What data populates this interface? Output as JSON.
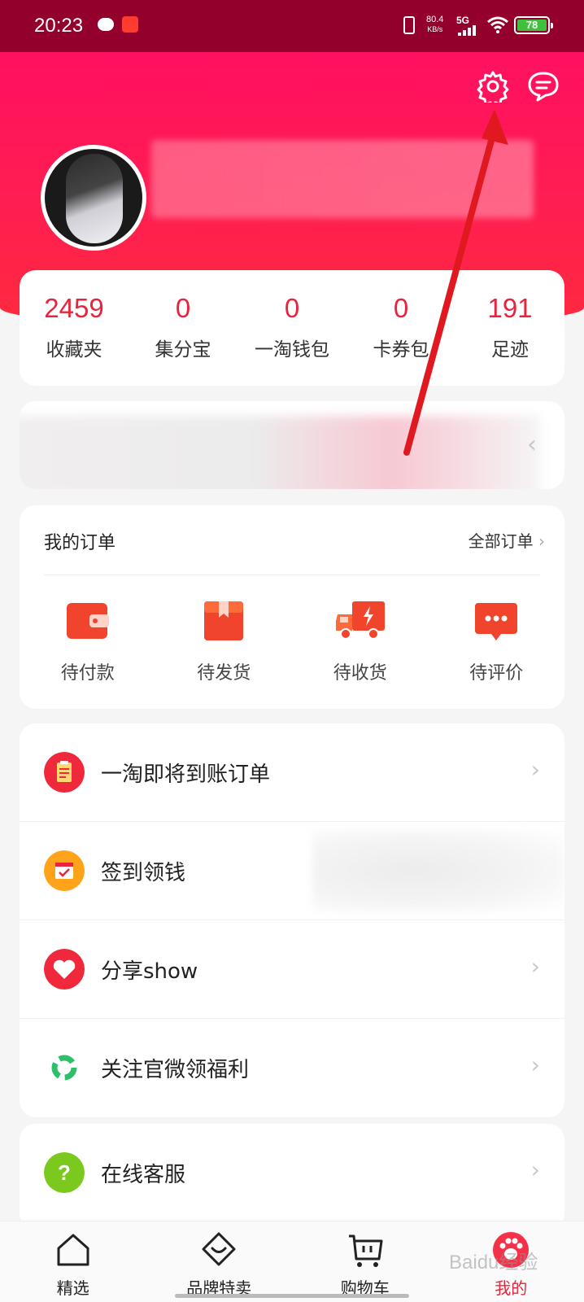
{
  "status_bar": {
    "time": "20:23",
    "net_speed_value": "80.4",
    "net_speed_unit": "KB/s",
    "network": "5G",
    "battery": "78"
  },
  "header": {
    "settings_icon": "gear-icon",
    "message_icon": "chat-bubble-icon"
  },
  "stats": [
    {
      "value": "2459",
      "label": "收藏夹"
    },
    {
      "value": "0",
      "label": "集分宝"
    },
    {
      "value": "0",
      "label": "一淘钱包"
    },
    {
      "value": "0",
      "label": "卡券包"
    },
    {
      "value": "191",
      "label": "足迹"
    }
  ],
  "banner": {
    "chevron": "‹"
  },
  "orders": {
    "title": "我的订单",
    "all_label": "全部订单",
    "chevron": "›",
    "items": [
      {
        "label": "待付款",
        "icon": "wallet-icon"
      },
      {
        "label": "待发货",
        "icon": "package-icon"
      },
      {
        "label": "待收货",
        "icon": "truck-icon"
      },
      {
        "label": "待评价",
        "icon": "comment-icon"
      }
    ]
  },
  "menu": [
    {
      "label": "一淘即将到账订单",
      "icon": "clipboard-icon",
      "color": "#f0283c"
    },
    {
      "label": "签到领钱",
      "icon": "calendar-check-icon",
      "color": "#ffa31a"
    },
    {
      "label": "分享show",
      "icon": "heart-icon",
      "color": "#f0283c"
    },
    {
      "label": "关注官微领福利",
      "icon": "recycle-icon",
      "color": "#2fbf6a"
    }
  ],
  "menu2": [
    {
      "label": "在线客服",
      "icon": "question-icon",
      "color": "#7bc91e"
    }
  ],
  "chevron": "›",
  "tabbar": [
    {
      "label": "精选",
      "icon": "home-icon"
    },
    {
      "label": "品牌特卖",
      "icon": "heart-badge-icon"
    },
    {
      "label": "购物车",
      "icon": "cart-icon"
    },
    {
      "label": "我的",
      "icon": "profile-paw-icon",
      "active": true
    }
  ],
  "watermark": "Baidu经验",
  "colors": {
    "accent": "#e8243c",
    "header_top": "#ff1060",
    "status_bar": "#93002c"
  }
}
